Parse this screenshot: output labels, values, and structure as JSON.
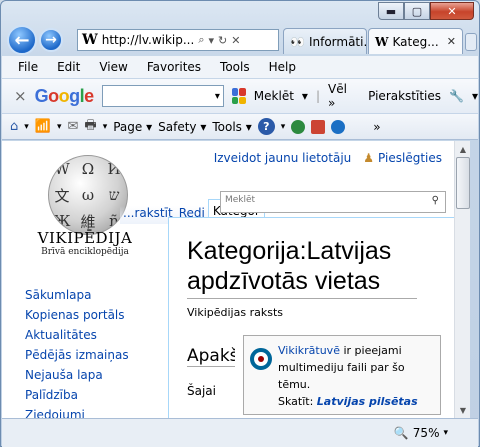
{
  "window": {
    "minimize": "▬",
    "maximize": "▢",
    "close": "✕"
  },
  "address": {
    "wiki_logo": "W",
    "url": "http://lv.wikip...",
    "search_icon": "⌕",
    "dropdown": "▾",
    "refresh": "↻",
    "stop": "✕"
  },
  "tabs": [
    {
      "icon": "👀",
      "label": "Informāti...",
      "close": "✕"
    },
    {
      "icon": "W",
      "label": "Kateg...",
      "close": "✕"
    }
  ],
  "menu": [
    "File",
    "Edit",
    "View",
    "Favorites",
    "Tools",
    "Help"
  ],
  "google_bar": {
    "close": "×",
    "logo": [
      "G",
      "o",
      "o",
      "g",
      "l",
      "e"
    ],
    "search_dropdown": "▾",
    "search_label": "Meklēt",
    "search_caret": "▾",
    "more": "Vēl »",
    "signin": "Pierakstīties",
    "wrench": "🔧",
    "caret": "▾"
  },
  "command_bar": {
    "home": "⌂",
    "feeds": "📶",
    "mail": "✉",
    "print": "🖶",
    "page": "Page ▾",
    "safety": "Safety ▾",
    "tools": "Tools ▾",
    "help": "?",
    "more": "»"
  },
  "page": {
    "create_account": "Izveidot jaunu lietotāju",
    "login": "Pieslēgties",
    "globe_letters": [
      "W",
      "Ω",
      "И",
      "文",
      "ω",
      "ש",
      "Ж",
      "維",
      "ñ"
    ],
    "wiki_title": "VIKIPĒDIJA",
    "wiki_subtitle": "Brīvā enciklopēdija",
    "tabs": [
      "...rakstīt",
      "Redi",
      "Kategor"
    ],
    "search_placeholder": "Meklēt",
    "nav": [
      "Sākumlapa",
      "Kopienas portāls",
      "Aktualitātes",
      "Pēdējās izmaiņas",
      "Nejauša lapa",
      "Palīdzība",
      "Ziedojumi"
    ],
    "heading": "Kategorija:Latvijas apdzīvotās vietas",
    "tagline": "Vikipēdijas raksts",
    "section": "Apakš",
    "section_text": "Šajai",
    "commons": {
      "link": "Vikikrātuvē",
      "text": " ir pieejami multimediju faili par šo tēmu.",
      "see": "Skatīt: ",
      "see_link": "Latvijas pilsētas"
    }
  },
  "status": {
    "zoom_icon": "🔍",
    "zoom": "75%",
    "caret": "▾"
  }
}
